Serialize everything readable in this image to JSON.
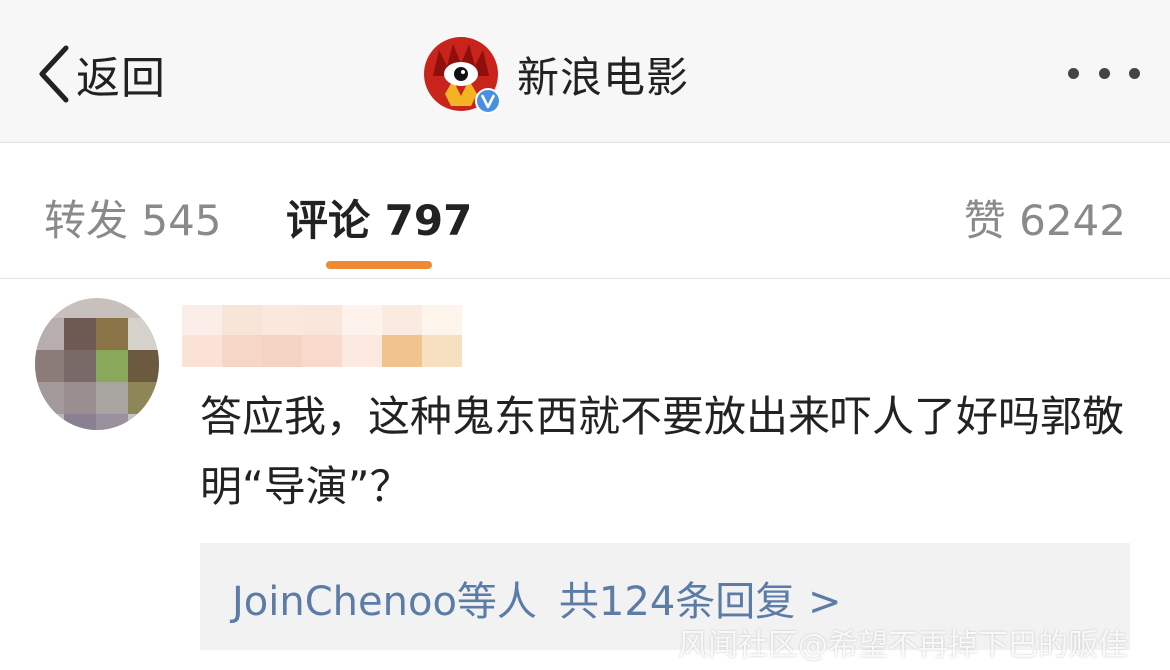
{
  "header": {
    "back_label": "返回",
    "account_name": "新浪电影",
    "verified_badge": "V",
    "back_icon": "chevron-left-icon",
    "more_icon": "ellipsis-icon"
  },
  "tabs": [
    {
      "label": "转发 545"
    },
    {
      "label": "评论 797"
    },
    {
      "label": "赞 6242"
    }
  ],
  "accent_color": "#f08a32",
  "comment": {
    "text": "答应我，这种鬼东西就不要放出来吓人了好吗郭敬明“导演”？",
    "replies": {
      "users_text": "JoinChenoo等人",
      "count_text": "共124条回复 >"
    }
  },
  "watermark": "风闻社区@希望不再掉下巴的贩佳"
}
